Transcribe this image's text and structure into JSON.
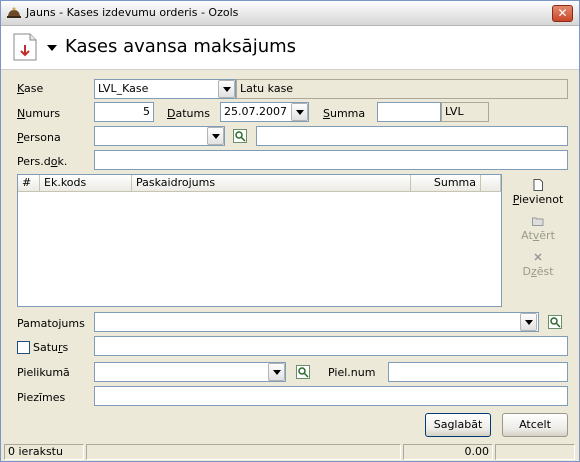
{
  "window": {
    "title": "Jauns - Kases izdevumu orderis - Ozols",
    "close_label": "✕"
  },
  "header": {
    "title": "Kases avansa maksājums"
  },
  "form": {
    "kase": {
      "label_u": "K",
      "label_rest": "ase",
      "value": "LVL_Kase",
      "name": "Latu kase"
    },
    "numurs": {
      "label_u": "N",
      "label_rest": "umurs",
      "value": "5"
    },
    "datums": {
      "label_u": "D",
      "label_rest": "atums",
      "value": "25.07.2007"
    },
    "summa": {
      "label_u": "S",
      "label_rest": "umma",
      "value": "",
      "currency": "LVL"
    },
    "persona": {
      "label_u": "P",
      "label_rest": "ersona",
      "value": "",
      "name": ""
    },
    "persdok": {
      "label_pre": "Pers.d",
      "label_u": "o",
      "label_rest": "k.",
      "value": ""
    },
    "pamatojums": {
      "label": "Pamatojums",
      "value": ""
    },
    "saturs": {
      "label_pre": "Satu",
      "label_u": "r",
      "label_rest": "s",
      "value": "",
      "checked": false
    },
    "pielikuma": {
      "label": "Pielikumā",
      "value": ""
    },
    "pielnum": {
      "label": "Piel.num",
      "value": ""
    },
    "piezimes": {
      "label": "Piezīmes",
      "value": ""
    }
  },
  "grid": {
    "columns": [
      "#",
      "Ek.kods",
      "Paskaidrojums",
      "Summa"
    ],
    "rows": []
  },
  "side_actions": {
    "add": {
      "label_u": "P",
      "label_rest": "ievienot"
    },
    "open": {
      "label_pre": "At",
      "label_u": "v",
      "label_rest": "ērt"
    },
    "delete": {
      "label_pre": "D",
      "label_u": "z",
      "label_rest": "ēst"
    }
  },
  "buttons": {
    "save": "Saglabāt",
    "cancel": "Atcelt"
  },
  "status": {
    "records": "0 ierakstu",
    "total": "0.00"
  }
}
